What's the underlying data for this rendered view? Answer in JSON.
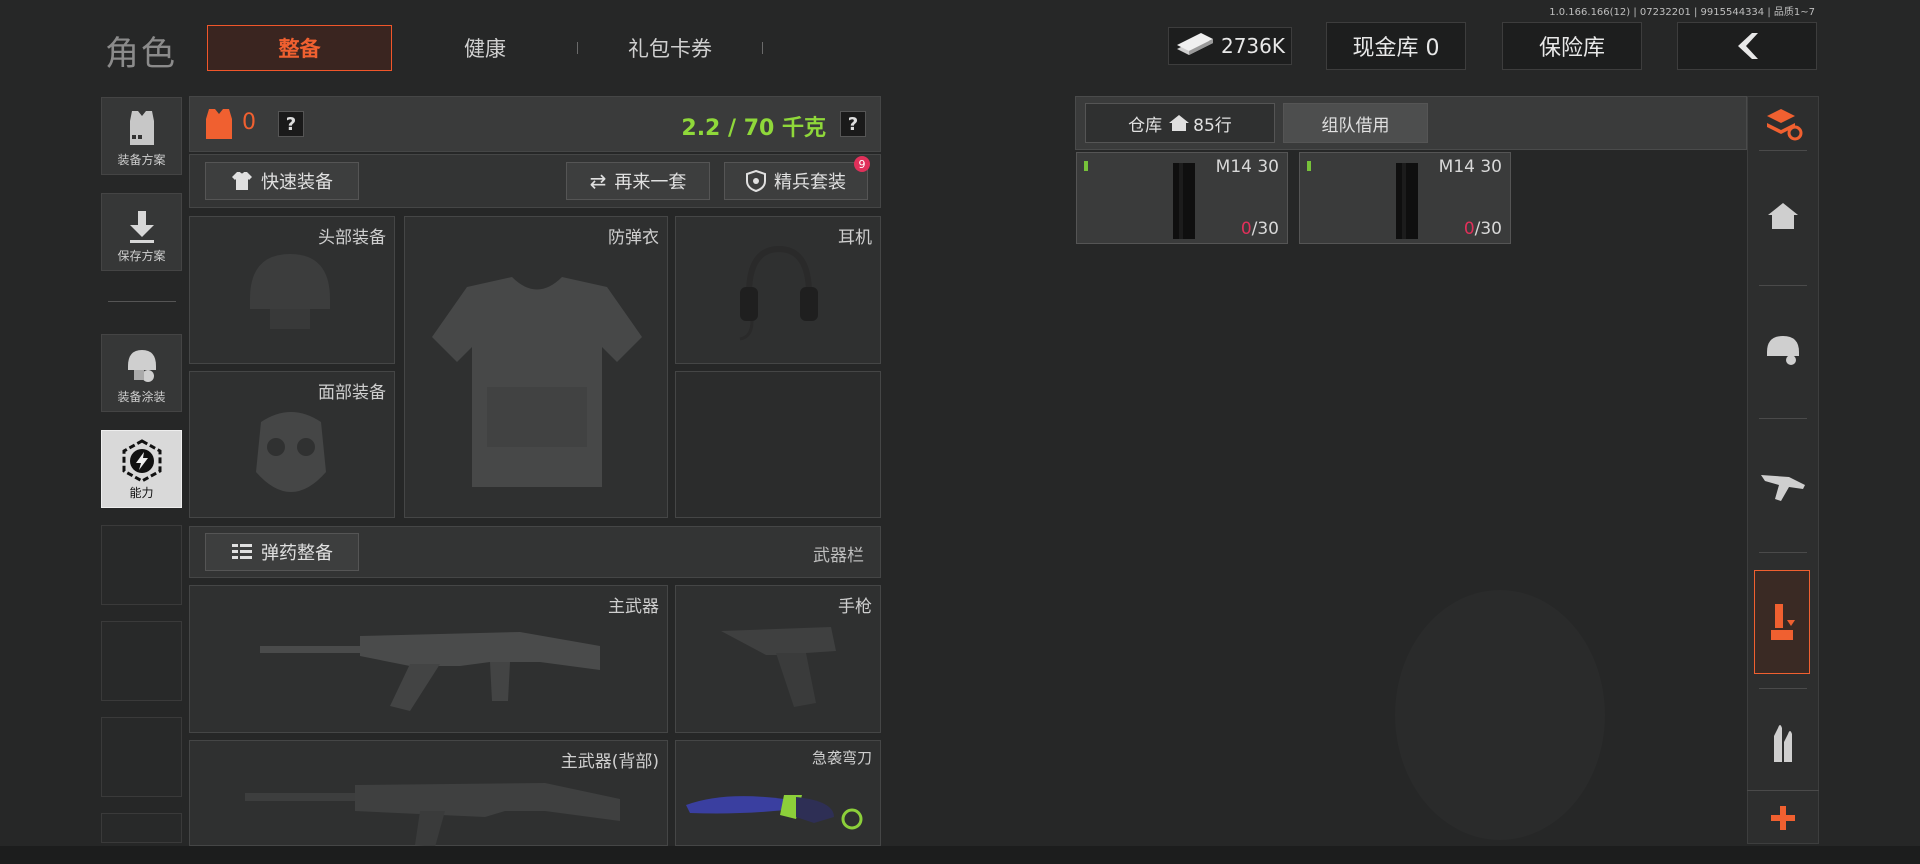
{
  "version": "1.0.166.166(12) | 07232201 | 9915544334 | 品质1~7",
  "header": {
    "title": "角色",
    "tabs": {
      "outfit": "整备",
      "health": "健康",
      "gift": "礼包卡券"
    },
    "money": "2736K",
    "cash_vault": "现金库 0",
    "insurance": "保险库",
    "back_icon": "chevron-left-icon"
  },
  "left_rail": {
    "plan": "装备方案",
    "save_plan": "保存方案",
    "skin": "装备涂装",
    "ability": "能力"
  },
  "loadout": {
    "armor_value": "0",
    "weight": "2.2 / 70 千克",
    "help": "?",
    "quick_equip": "快速装备",
    "again": "再来一套",
    "elite": "精兵套装",
    "elite_badge": "9",
    "slots": {
      "head": "头部装备",
      "vest": "防弹衣",
      "headset": "耳机",
      "face": "面部装备"
    },
    "ammo_prep": "弹药整备",
    "weapon_bar": "武器栏",
    "weapons": {
      "primary": "主武器",
      "pistol": "手枪",
      "primary_back": "主武器(背部)",
      "knife": "急袭弯刀"
    }
  },
  "warehouse": {
    "tab_storage": "仓库",
    "rows": "85行",
    "tab_team": "组队借用",
    "items": [
      {
        "name": "M14 30",
        "current": "0",
        "max": "/30"
      },
      {
        "name": "M14 30",
        "current": "0",
        "max": "/30"
      }
    ]
  },
  "colors": {
    "accent": "#f06030",
    "weight_green": "#8fd83a",
    "badge_red": "#e0305a"
  }
}
